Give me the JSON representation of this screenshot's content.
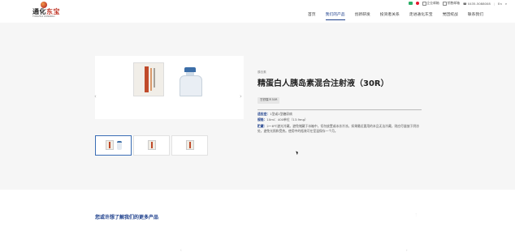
{
  "header": {
    "logo_text_a": "通化",
    "logo_text_b": "东宝",
    "logo_sub": "TONGHUA DONGBAO",
    "topbar": {
      "corp_mail": "企业邮箱",
      "sales_mail": "销售邮箱",
      "phone": "0435-5088008",
      "lang_cn": "En",
      "search_icon": "search-icon"
    },
    "nav": [
      "首页",
      "我们的产品",
      "创新研发",
      "投资者关系",
      "走进通化东宝",
      "党团统战",
      "联系我们"
    ],
    "active_nav": 1
  },
  "product": {
    "breadcrumb": "胰岛素",
    "title": "精蛋白人胰岛素混合注射液（30R）",
    "badge": "甘舒霖®30R",
    "specs": [
      {
        "label": "适应症：",
        "text": "1型或2型糖尿病"
      },
      {
        "label": "规格：",
        "text": "10ml：400单位（13.9mg）"
      },
      {
        "label": "贮藏：",
        "text": "2～8℃避光冷藏。避免储藏于冰箱中，切勿放置或冰冻冷凉。如果最近要用的本品无法冷藏，则应尽量放于阴凉处，避免光照和受热。使用中的瓶装可在室温保存一个月。"
      }
    ],
    "arrows": {
      "left": "‹",
      "right": "›"
    }
  },
  "more": {
    "title": "您或许想了解我们的更多产品",
    "mark": "⋮",
    "peek_left": "‹",
    "peek_right": "›"
  },
  "colors": {
    "accent": "#1d3f8c",
    "brand_red": "#c0392b",
    "section_bg": "#f6f6f6"
  }
}
